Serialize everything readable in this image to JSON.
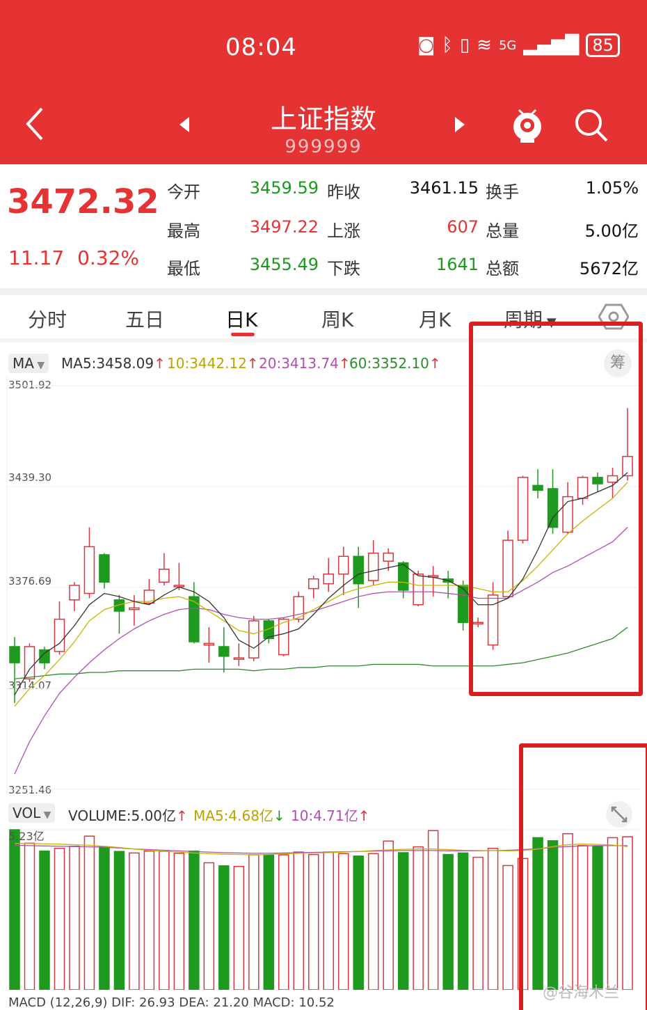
{
  "status_bar": {
    "time": "08:04",
    "battery": "85",
    "signal": "5G"
  },
  "header": {
    "title": "上证指数",
    "code": "999999"
  },
  "quote": {
    "price": "3472.32",
    "change": "11.17",
    "change_pct": "0.32%",
    "rows": [
      {
        "l1": "今开",
        "v1": "3459.59",
        "l2": "昨收",
        "v2": "3461.15",
        "l3": "换手",
        "v3": "1.05%"
      },
      {
        "l1": "最高",
        "v1": "3497.22",
        "l2": "上涨",
        "v2": "607",
        "l3": "总量",
        "v3": "5.00亿"
      },
      {
        "l1": "最低",
        "v1": "3455.49",
        "l2": "下跌",
        "v2": "1641",
        "l3": "总额",
        "v3": "5672亿"
      }
    ]
  },
  "tabs": [
    "分时",
    "五日",
    "日K",
    "周K",
    "月K",
    "周期"
  ],
  "ma_legend": {
    "selector": "MA",
    "ma5": "MA5:3458.09",
    "ma10": "10:3442.12",
    "ma20": "20:3413.74",
    "ma60": "60:3352.10",
    "chip": "筹"
  },
  "y_labels": [
    "3501.92",
    "3439.30",
    "3376.69",
    "3314.07",
    "3251.46"
  ],
  "vol_legend": {
    "selector": "VOL",
    "volume": "VOLUME:5.00亿",
    "ma5": "MA5:4.68亿",
    "ma10": "10:4.71亿",
    "max": "5.23亿"
  },
  "macd_legend": {
    "text": "MACD (12,26,9) DIF: 26.93  DEA: 21.20  MACD: 10.52"
  },
  "watermark": "@谷海木兰",
  "colors": {
    "up": "#d9363e",
    "down": "#1e9a1e",
    "header": "#e53333",
    "ma5": "#333333",
    "ma10": "#c9b400",
    "ma20": "#b04fb0",
    "ma60": "#2f8a2f",
    "highlight": "#d92020"
  },
  "chart_data": {
    "type": "candlestick",
    "ylim": [
      3251.46,
      3501.92
    ],
    "y_ticks": [
      3501.92,
      3439.3,
      3376.69,
      3314.07,
      3251.46
    ],
    "candles": [
      {
        "o": 3340,
        "c": 3330,
        "h": 3346,
        "l": 3305
      },
      {
        "o": 3320,
        "c": 3340,
        "h": 3342,
        "l": 3318
      },
      {
        "o": 3338,
        "c": 3330,
        "h": 3340,
        "l": 3326
      },
      {
        "o": 3337,
        "c": 3357,
        "h": 3368,
        "l": 3335
      },
      {
        "o": 3369,
        "c": 3378,
        "h": 3380,
        "l": 3362
      },
      {
        "o": 3373,
        "c": 3402,
        "h": 3414,
        "l": 3370
      },
      {
        "o": 3397,
        "c": 3380,
        "h": 3398,
        "l": 3376
      },
      {
        "o": 3369,
        "c": 3362,
        "h": 3372,
        "l": 3348
      },
      {
        "o": 3363,
        "c": 3364,
        "h": 3372,
        "l": 3353
      },
      {
        "o": 3367,
        "c": 3375,
        "h": 3382,
        "l": 3366
      },
      {
        "o": 3380,
        "c": 3388,
        "h": 3398,
        "l": 3378
      },
      {
        "o": 3378,
        "c": 3378,
        "h": 3392,
        "l": 3375
      },
      {
        "o": 3371,
        "c": 3343,
        "h": 3380,
        "l": 3342
      },
      {
        "o": 3341,
        "c": 3342,
        "h": 3352,
        "l": 3330
      },
      {
        "o": 3340,
        "c": 3334,
        "h": 3352,
        "l": 3324
      },
      {
        "o": 3333,
        "c": 3333,
        "h": 3342,
        "l": 3328
      },
      {
        "o": 3333,
        "c": 3356,
        "h": 3359,
        "l": 3331
      },
      {
        "o": 3356,
        "c": 3345,
        "h": 3357,
        "l": 3342
      },
      {
        "o": 3335,
        "c": 3357,
        "h": 3358,
        "l": 3334
      },
      {
        "o": 3357,
        "c": 3371,
        "h": 3374,
        "l": 3355
      },
      {
        "o": 3376,
        "c": 3382,
        "h": 3384,
        "l": 3370
      },
      {
        "o": 3379,
        "c": 3385,
        "h": 3395,
        "l": 3374
      },
      {
        "o": 3385,
        "c": 3396,
        "h": 3402,
        "l": 3372
      },
      {
        "o": 3396,
        "c": 3379,
        "h": 3402,
        "l": 3364
      },
      {
        "o": 3381,
        "c": 3398,
        "h": 3406,
        "l": 3378
      },
      {
        "o": 3393,
        "c": 3398,
        "h": 3401,
        "l": 3387
      },
      {
        "o": 3392,
        "c": 3375,
        "h": 3393,
        "l": 3370
      },
      {
        "o": 3366,
        "c": 3385,
        "h": 3387,
        "l": 3365
      },
      {
        "o": 3384,
        "c": 3384,
        "h": 3390,
        "l": 3371
      },
      {
        "o": 3382,
        "c": 3380,
        "h": 3387,
        "l": 3370
      },
      {
        "o": 3378,
        "c": 3355,
        "h": 3381,
        "l": 3350
      },
      {
        "o": 3355,
        "c": 3355,
        "h": 3358,
        "l": 3352
      },
      {
        "o": 3341,
        "c": 3372,
        "h": 3380,
        "l": 3338
      },
      {
        "o": 3371,
        "c": 3406,
        "h": 3412,
        "l": 3370
      },
      {
        "o": 3406,
        "c": 3445,
        "h": 3446,
        "l": 3404
      },
      {
        "o": 3440,
        "c": 3437,
        "h": 3450,
        "l": 3432
      },
      {
        "o": 3438,
        "c": 3414,
        "h": 3450,
        "l": 3410
      },
      {
        "o": 3411,
        "c": 3433,
        "h": 3442,
        "l": 3410
      },
      {
        "o": 3432,
        "c": 3445,
        "h": 3446,
        "l": 3428
      },
      {
        "o": 3445,
        "c": 3441,
        "h": 3448,
        "l": 3436
      },
      {
        "o": 3442,
        "c": 3446,
        "h": 3451,
        "l": 3432
      },
      {
        "o": 3446,
        "c": 3458,
        "h": 3488,
        "l": 3443
      }
    ],
    "ma5": [
      3310,
      3326,
      3336,
      3342,
      3353,
      3366,
      3373,
      3371,
      3368,
      3366,
      3372,
      3377,
      3374,
      3368,
      3358,
      3344,
      3339,
      3346,
      3348,
      3351,
      3360,
      3370,
      3378,
      3385,
      3387,
      3389,
      3391,
      3384,
      3383,
      3381,
      3376,
      3366,
      3366,
      3370,
      3382,
      3400,
      3420,
      3430,
      3432,
      3436,
      3440,
      3448
    ],
    "ma10": [
      3303,
      3314,
      3322,
      3332,
      3343,
      3356,
      3363,
      3366,
      3368,
      3368,
      3370,
      3371,
      3368,
      3362,
      3356,
      3350,
      3348,
      3351,
      3355,
      3358,
      3363,
      3368,
      3373,
      3376,
      3378,
      3380,
      3380,
      3378,
      3378,
      3378,
      3378,
      3376,
      3374,
      3374,
      3381,
      3390,
      3400,
      3410,
      3418,
      3425,
      3432,
      3442
    ],
    "ma20": [
      3261,
      3281,
      3297,
      3311,
      3321,
      3330,
      3338,
      3345,
      3351,
      3356,
      3360,
      3363,
      3364,
      3363,
      3360,
      3358,
      3357,
      3357,
      3358,
      3360,
      3362,
      3365,
      3368,
      3371,
      3373,
      3374,
      3374,
      3374,
      3374,
      3373,
      3372,
      3370,
      3370,
      3370,
      3375,
      3380,
      3386,
      3390,
      3395,
      3400,
      3405,
      3414
    ],
    "ma60": [
      3320,
      3321,
      3322,
      3323,
      3323,
      3324,
      3324,
      3325,
      3325,
      3325,
      3325,
      3325,
      3326,
      3326,
      3326,
      3326,
      3325,
      3326,
      3326,
      3327,
      3327,
      3328,
      3328,
      3328,
      3329,
      3329,
      3329,
      3329,
      3328,
      3328,
      3328,
      3328,
      3328,
      3329,
      3330,
      3332,
      3334,
      3336,
      3339,
      3342,
      3345,
      3352
    ],
    "volume": {
      "ylim": [
        0,
        5.23
      ],
      "values": [
        5.23,
        4.79,
        4.53,
        4.62,
        4.69,
        5.02,
        4.67,
        4.52,
        4.47,
        4.53,
        4.52,
        4.46,
        4.53,
        4.15,
        4.05,
        4.03,
        4.41,
        4.4,
        4.41,
        4.5,
        4.42,
        4.5,
        4.45,
        4.37,
        4.45,
        4.86,
        4.48,
        4.67,
        5.2,
        4.42,
        4.47,
        4.33,
        4.62,
        4.06,
        4.29,
        4.97,
        4.87,
        5.1,
        4.71,
        4.68,
        4.97,
        5.0
      ],
      "ma5": [
        4.78,
        4.78,
        4.77,
        4.76,
        4.74,
        4.72,
        4.69,
        4.65,
        4.6,
        4.55,
        4.52,
        4.5,
        4.47,
        4.45,
        4.43,
        4.42,
        4.41,
        4.42,
        4.44,
        4.46,
        4.47,
        4.48,
        4.5,
        4.52,
        4.55,
        4.57,
        4.59,
        4.6,
        4.6,
        4.58,
        4.56,
        4.55,
        4.55,
        4.54,
        4.55,
        4.6,
        4.68,
        4.74,
        4.76,
        4.75,
        4.73,
        4.68
      ],
      "ma10": [
        4.72,
        4.71,
        4.7,
        4.69,
        4.68,
        4.67,
        4.66,
        4.63,
        4.6,
        4.58,
        4.56,
        4.54,
        4.52,
        4.5,
        4.48,
        4.47,
        4.46,
        4.46,
        4.47,
        4.48,
        4.49,
        4.5,
        4.51,
        4.52,
        4.53,
        4.54,
        4.55,
        4.55,
        4.55,
        4.54,
        4.54,
        4.54,
        4.55,
        4.56,
        4.58,
        4.61,
        4.65,
        4.68,
        4.7,
        4.71,
        4.71,
        4.71
      ]
    }
  }
}
